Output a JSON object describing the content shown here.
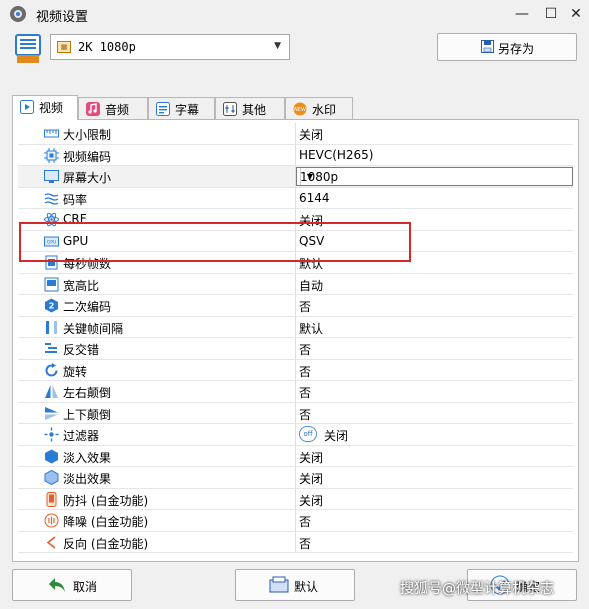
{
  "window": {
    "title": "视频设置",
    "minimize": "—",
    "maximize": "☐",
    "close": "✕"
  },
  "toolbar": {
    "preset_value": "2K 1080p",
    "preset_icon": "film-icon",
    "save_as_label": "另存为"
  },
  "tabs": [
    {
      "label": "视频",
      "icon": "video-tab-icon",
      "active": true
    },
    {
      "label": "音频",
      "icon": "music-note-icon",
      "active": false
    },
    {
      "label": "字幕",
      "icon": "subtitle-icon",
      "active": false
    },
    {
      "label": "其他",
      "icon": "settings-sliders-icon",
      "active": false
    },
    {
      "label": "水印",
      "icon": "watermark-new-icon",
      "active": false
    }
  ],
  "settings": [
    {
      "name": "大小限制",
      "value": "关闭",
      "icon": "ruler-icon"
    },
    {
      "name": "视频编码",
      "value": "HEVC(H265)",
      "icon": "chip-icon"
    },
    {
      "name": "屏幕大小",
      "value": "1080p",
      "icon": "monitor-icon",
      "selected": true
    },
    {
      "name": "码率",
      "value": "6144",
      "icon": "waves-icon"
    },
    {
      "name": "CRF",
      "value": "关闭",
      "icon": "atom-icon"
    },
    {
      "name": "GPU",
      "value": "QSV",
      "icon": "gpu-icon"
    },
    {
      "name": "每秒帧数",
      "value": "默认",
      "icon": "film-frame-icon"
    },
    {
      "name": "宽高比",
      "value": "自动",
      "icon": "aspect-ratio-icon"
    },
    {
      "name": "二次编码",
      "value": "否",
      "icon": "two-pass-icon"
    },
    {
      "name": "关键帧间隔",
      "value": "默认",
      "icon": "keyframe-icon"
    },
    {
      "name": "反交错",
      "value": "否",
      "icon": "deinterlace-icon"
    },
    {
      "name": "旋转",
      "value": "否",
      "icon": "rotate-icon"
    },
    {
      "name": "左右颠倒",
      "value": "否",
      "icon": "flip-horizontal-icon"
    },
    {
      "name": "上下颠倒",
      "value": "否",
      "icon": "flip-vertical-icon"
    },
    {
      "name": "过滤器",
      "value": "关闭",
      "icon": "filter-icon",
      "toggle": "off"
    },
    {
      "name": "淡入效果",
      "value": "关闭",
      "icon": "fade-in-icon"
    },
    {
      "name": "淡出效果",
      "value": "关闭",
      "icon": "fade-out-icon"
    },
    {
      "name": "防抖 (白金功能)",
      "value": "关闭",
      "icon": "stabilize-icon"
    },
    {
      "name": "降噪 (白金功能)",
      "value": "否",
      "icon": "denoise-icon"
    },
    {
      "name": "反向 (白金功能)",
      "value": "否",
      "icon": "reverse-icon"
    }
  ],
  "footer": {
    "cancel_label": "取消",
    "default_label": "默认",
    "ok_label": "确定"
  },
  "watermark_text": "搜狐号@微型计算机杂志",
  "colors": {
    "highlight": "#d22a2a",
    "accent_blue": "#2a7bd4",
    "green_arrow": "#2e8b3a"
  }
}
